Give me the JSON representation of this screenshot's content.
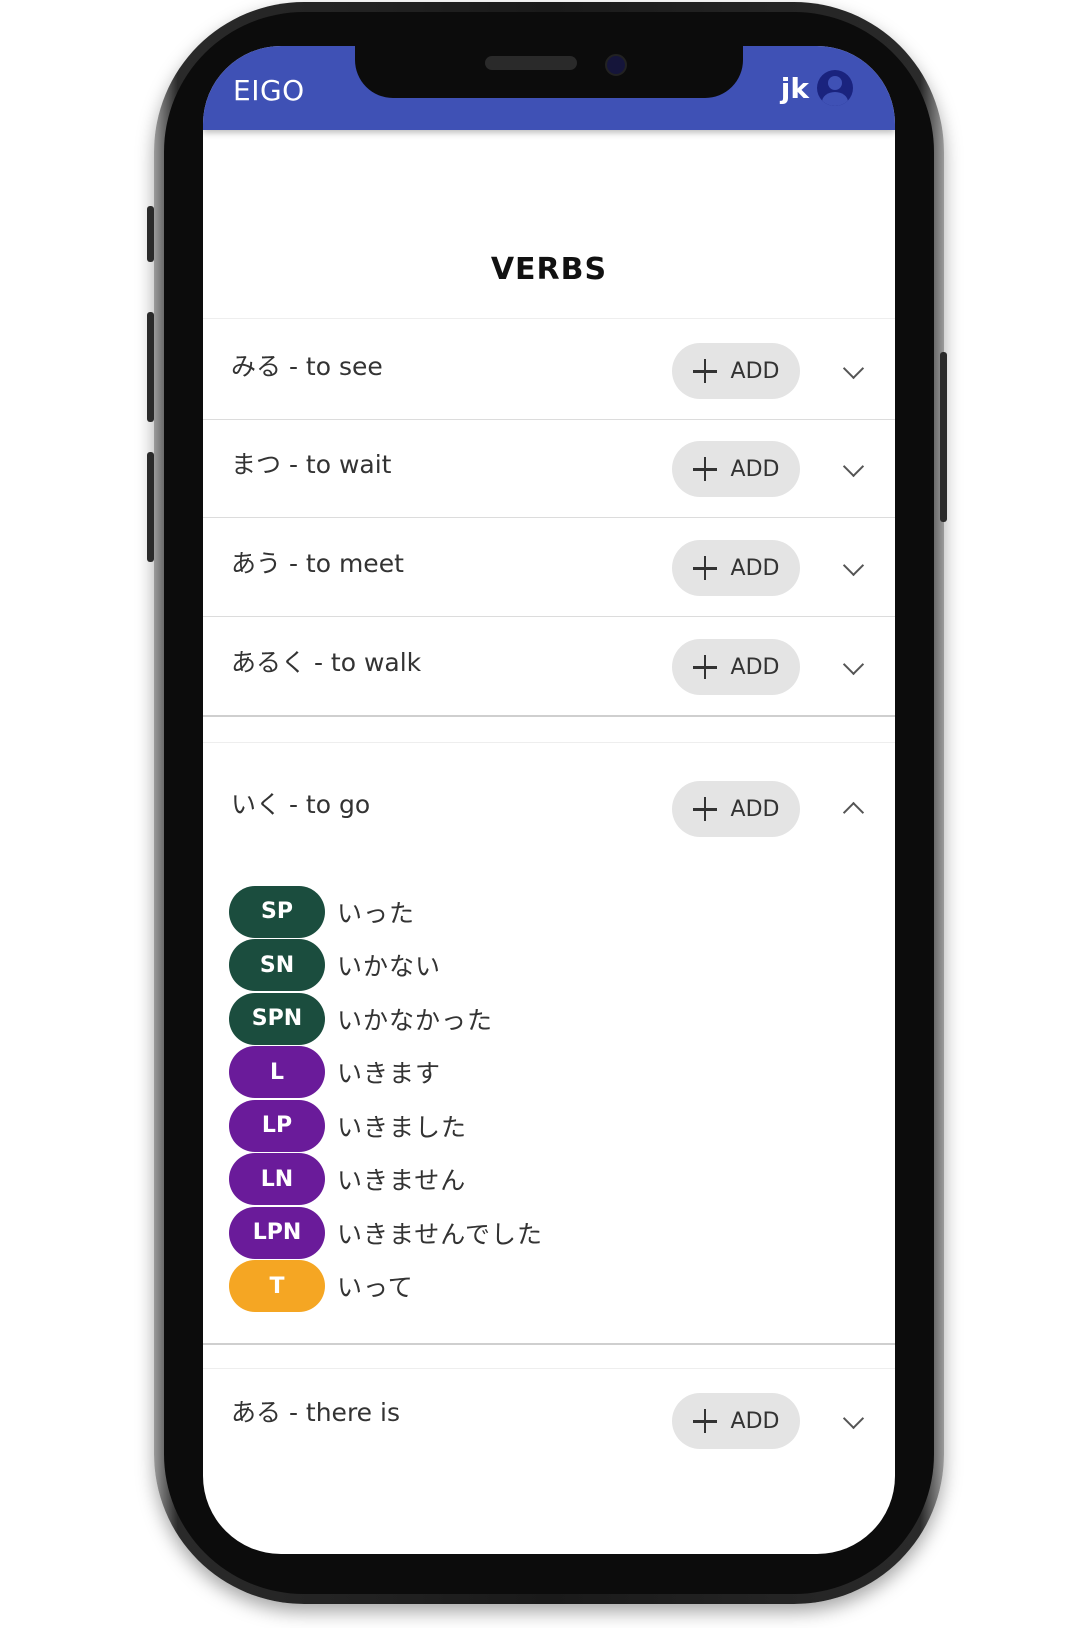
{
  "appbar": {
    "title": "EIGO",
    "user": "jk",
    "color": "#3f51b5"
  },
  "page": {
    "title": "VERBS"
  },
  "add_label": "ADD",
  "verbs": [
    {
      "label": "みる - to see"
    },
    {
      "label": "まつ - to wait"
    },
    {
      "label": "あう - to meet"
    },
    {
      "label": "あるく - to walk"
    },
    {
      "label": "いく - to go"
    },
    {
      "label": "ある - there is"
    }
  ],
  "forms": [
    {
      "code": "SP",
      "text": "いった",
      "color": "#1b4d3e"
    },
    {
      "code": "SN",
      "text": "いかない",
      "color": "#1b4d3e"
    },
    {
      "code": "SPN",
      "text": "いかなかった",
      "color": "#1b4d3e"
    },
    {
      "code": "L",
      "text": "いきます",
      "color": "#6a1b9a"
    },
    {
      "code": "LP",
      "text": "いきました",
      "color": "#6a1b9a"
    },
    {
      "code": "LN",
      "text": "いきません",
      "color": "#6a1b9a"
    },
    {
      "code": "LPN",
      "text": "いきませんでした",
      "color": "#6a1b9a"
    },
    {
      "code": "T",
      "text": "いって",
      "color": "#f5a623"
    }
  ]
}
